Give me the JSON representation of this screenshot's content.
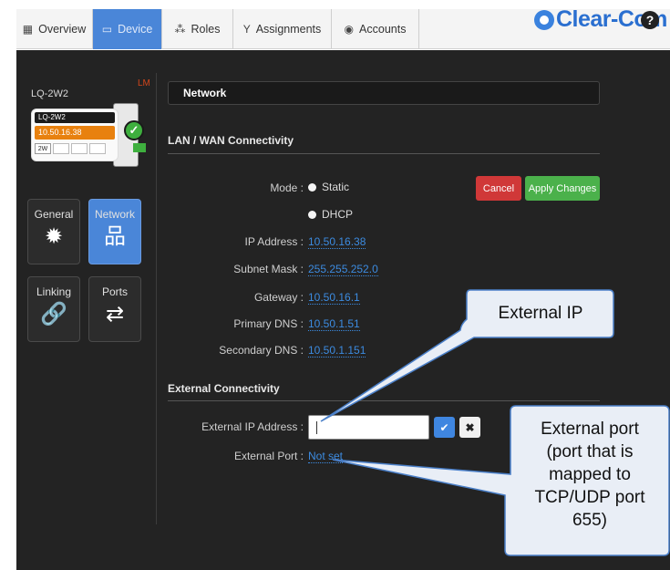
{
  "nav": {
    "tabs": [
      {
        "label": "Overview",
        "icon": "grid-icon",
        "active": false
      },
      {
        "label": "Device",
        "icon": "monitor-icon",
        "active": true
      },
      {
        "label": "Roles",
        "icon": "people-icon",
        "active": false
      },
      {
        "label": "Assignments",
        "icon": "fork-icon",
        "active": false
      },
      {
        "label": "Accounts",
        "icon": "globe-icon",
        "active": false
      }
    ],
    "brand": "Clear-Com",
    "help_glyph": "?"
  },
  "device": {
    "name": "LQ-2W2",
    "badge": "LM",
    "card_name": "LQ-2W2",
    "card_ip": "10.50.16.38",
    "card_port": "2W",
    "status_glyph": "✓"
  },
  "sidebar": {
    "items": [
      {
        "label": "General",
        "icon": "gear-icon",
        "glyph": "✹",
        "active": false
      },
      {
        "label": "Network",
        "icon": "network-icon",
        "glyph": "品",
        "active": true
      },
      {
        "label": "Linking",
        "icon": "link-icon",
        "glyph": "🔗",
        "active": false
      },
      {
        "label": "Ports",
        "icon": "swap-arrows-icon",
        "glyph": "⇄",
        "active": false
      }
    ]
  },
  "main": {
    "header": "Network",
    "lan_section": "LAN / WAN Connectivity",
    "mode_label": "Mode :",
    "mode_options": [
      "Static",
      "DHCP"
    ],
    "mode_selected": "Static",
    "cancel_label": "Cancel",
    "apply_label": "Apply Changes",
    "fields": [
      {
        "label": "IP Address :",
        "value": "10.50.16.38"
      },
      {
        "label": "Subnet Mask :",
        "value": "255.255.252.0"
      },
      {
        "label": "Gateway :",
        "value": "10.50.16.1"
      },
      {
        "label": "Primary DNS :",
        "value": "10.50.1.51"
      },
      {
        "label": "Secondary DNS :",
        "value": "10.50.1.151"
      }
    ],
    "ext_section": "External Connectivity",
    "ext_ip_label": "External IP Address :",
    "ext_ip_value": "",
    "ext_port_label": "External Port :",
    "ext_port_value": "Not set",
    "confirm_glyph": "✔",
    "clear_glyph": "✖"
  },
  "callouts": {
    "external_ip": "External IP",
    "external_port": [
      "External port",
      "(port that is",
      "mapped to",
      "TCP/UDP port",
      "655)"
    ]
  },
  "colors": {
    "accent": "#4a86d8",
    "cancel": "#d03838",
    "apply": "#4bb14b",
    "link": "#3c8be0",
    "orange": "#e8810f"
  }
}
